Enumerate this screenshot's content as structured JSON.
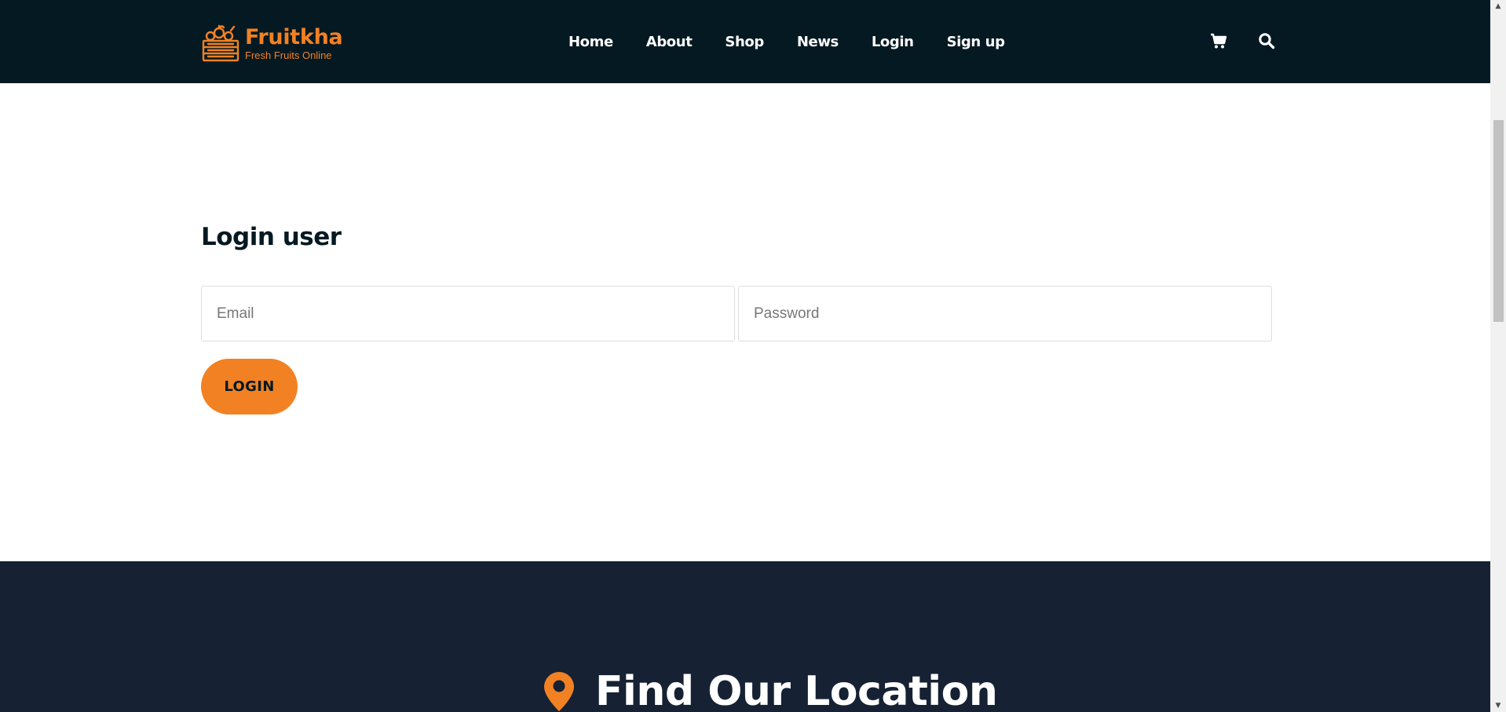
{
  "brand": {
    "name": "Fruitkha",
    "tagline": "Fresh Fruits Online",
    "accent_color": "#F28123",
    "logo_icon": "fruit-crate-icon"
  },
  "nav": {
    "items": [
      {
        "label": "Home"
      },
      {
        "label": "About"
      },
      {
        "label": "Shop"
      },
      {
        "label": "News"
      },
      {
        "label": "Login"
      },
      {
        "label": "Sign up"
      }
    ]
  },
  "header_icons": {
    "cart": "shopping-cart-icon",
    "search": "search-icon"
  },
  "login": {
    "title": "Login user",
    "email_placeholder": "Email",
    "password_placeholder": "Password",
    "submit_label": "LOGIN"
  },
  "location": {
    "title": "Find Our Location",
    "icon": "map-marker-icon"
  },
  "colors": {
    "header_bg": "#051922",
    "footer_bg": "#162133",
    "accent": "#F28123"
  }
}
